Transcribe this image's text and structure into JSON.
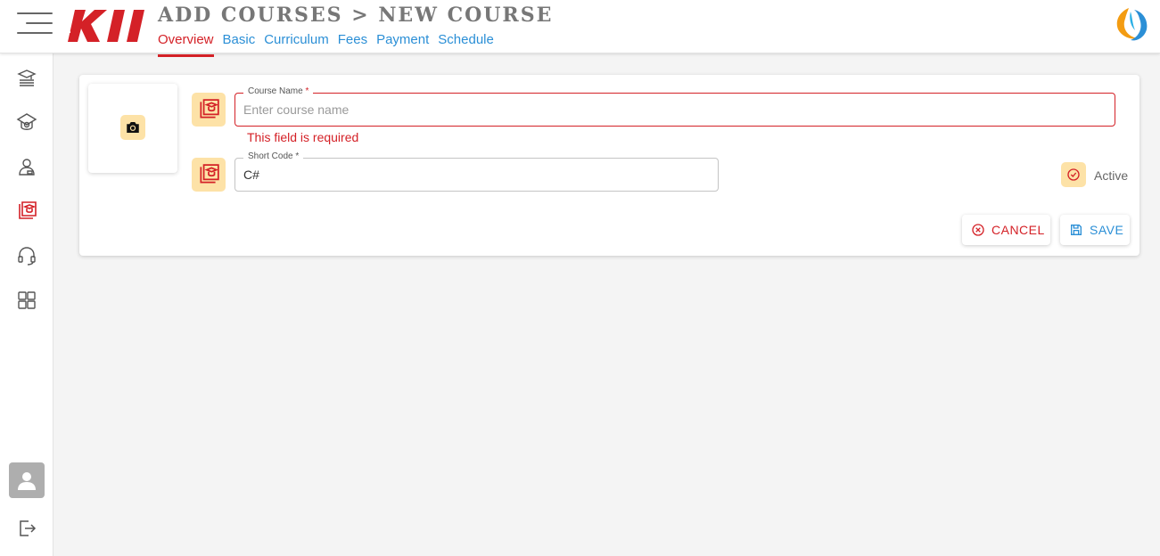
{
  "header": {
    "title": "ADD COURSES > NEW COURSE",
    "tabs": [
      {
        "label": "Overview",
        "active": true
      },
      {
        "label": "Basic",
        "active": false
      },
      {
        "label": "Curriculum",
        "active": false
      },
      {
        "label": "Fees",
        "active": false
      },
      {
        "label": "Payment",
        "active": false
      },
      {
        "label": "Schedule",
        "active": false
      }
    ]
  },
  "sidebar": {
    "items": [
      {
        "icon": "courses-stack-icon"
      },
      {
        "icon": "institute-icon"
      },
      {
        "icon": "students-icon"
      },
      {
        "icon": "course-book-icon",
        "active": true
      },
      {
        "icon": "support-headset-icon"
      },
      {
        "icon": "dashboard-grid-icon"
      }
    ],
    "bottom": [
      {
        "icon": "user-avatar-icon"
      },
      {
        "icon": "logout-icon"
      }
    ]
  },
  "form": {
    "course_name": {
      "label": "Course Name",
      "required_mark": "*",
      "value": "",
      "placeholder": "Enter course name",
      "error": "This field is required"
    },
    "short_code": {
      "label": "Short Code",
      "required_mark": "*",
      "value": "C#",
      "placeholder": ""
    },
    "active_label": "Active",
    "active_checked": true,
    "cancel_label": "CANCEL",
    "save_label": "SAVE"
  },
  "colors": {
    "accent_red": "#d42127",
    "link_blue": "#2b8fd6",
    "icon_bg": "#fde2a7"
  }
}
